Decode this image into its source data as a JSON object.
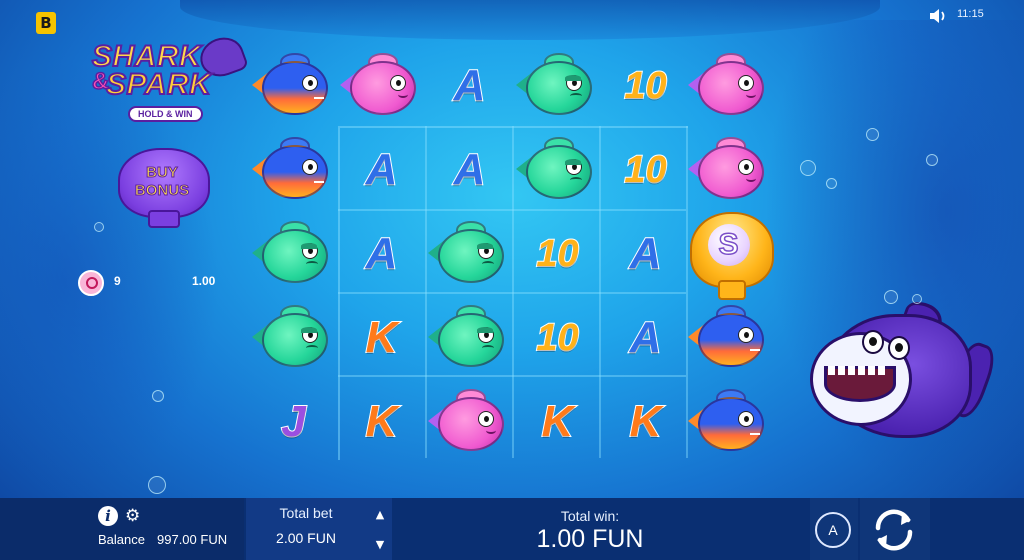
{
  "brand": {
    "badge": "B"
  },
  "status": {
    "time": "11:15",
    "sound_icon": "speaker-icon"
  },
  "logo": {
    "line1": "SHARK",
    "amp": "&",
    "line2": "SPARK",
    "subtitle": "HOLD & WIN"
  },
  "buy_bonus": {
    "line1": "BUY",
    "line2": "BONUS"
  },
  "counter": {
    "icon": "pearl-shell-icon",
    "count": "9",
    "value": "1.00"
  },
  "reels": {
    "rows": [
      [
        "fish-blue",
        "fish-pink",
        "A",
        "fish-green",
        "10",
        "fish-pink"
      ],
      [
        "fish-blue",
        "A",
        "A",
        "fish-green",
        "10",
        "fish-pink"
      ],
      [
        "fish-green",
        "A",
        "fish-green",
        "10",
        "A",
        "scatter"
      ],
      [
        "fish-green",
        "K",
        "fish-green",
        "10",
        "A",
        "fish-blue"
      ],
      [
        "J",
        "K",
        "fish-pink",
        "K",
        "K",
        "fish-blue"
      ]
    ],
    "scatter_letter": "S"
  },
  "bottom": {
    "balance_label": "Balance",
    "balance_value": "997.00 FUN",
    "total_bet_label": "Total bet",
    "total_bet_value": "2.00 FUN",
    "total_win_label": "Total win:",
    "total_win_value": "1.00 FUN",
    "auto_label": "A",
    "bet_up": "▲",
    "bet_down": "▼",
    "info_label": "i",
    "settings_icon": "⚙"
  }
}
